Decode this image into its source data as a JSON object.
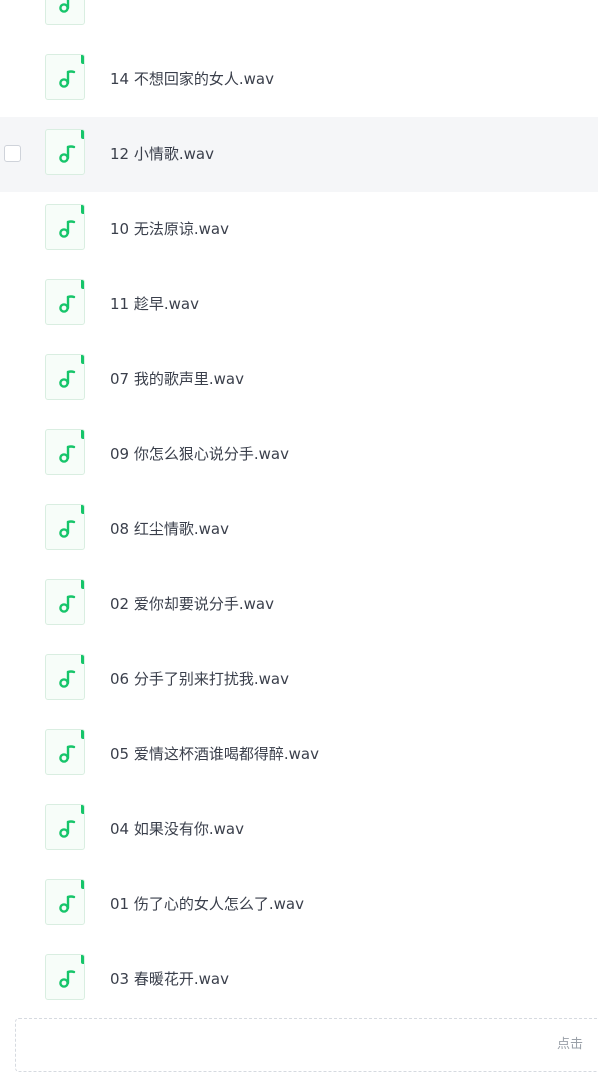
{
  "colors": {
    "icon_accent": "#16c56a",
    "hover_row_bg": "#f5f6f8",
    "text": "#3a3f4b",
    "muted_text": "#9aa0a8"
  },
  "file_list": {
    "icon_name": "music-note-icon",
    "files": [
      {
        "name": ""
      },
      {
        "name": "14 不想回家的女人.wav"
      },
      {
        "name": "12 小情歌.wav"
      },
      {
        "name": "10 无法原谅.wav"
      },
      {
        "name": "11 趁早.wav"
      },
      {
        "name": "07 我的歌声里.wav"
      },
      {
        "name": "09 你怎么狠心说分手.wav"
      },
      {
        "name": "08 红尘情歌.wav"
      },
      {
        "name": "02 爱你却要说分手.wav"
      },
      {
        "name": "06 分手了别来打扰我.wav"
      },
      {
        "name": "05 爱情这杯酒谁喝都得醉.wav"
      },
      {
        "name": "04 如果没有你.wav"
      },
      {
        "name": "01 伤了心的女人怎么了.wav"
      },
      {
        "name": "03 春暖花开.wav"
      }
    ]
  },
  "upload_zone": {
    "text": "点击"
  }
}
